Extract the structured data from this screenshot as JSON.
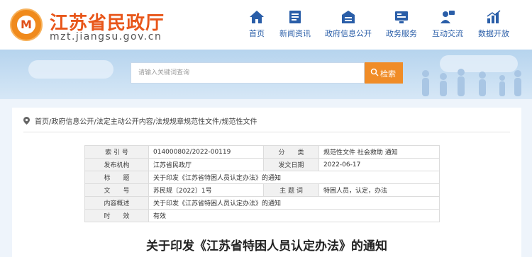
{
  "site": {
    "title": "江苏省民政厅",
    "url": "mzt.jiangsu.gov.cn",
    "logo_mark": "M"
  },
  "nav": [
    {
      "label": "首页",
      "icon": "home-icon"
    },
    {
      "label": "新闻资讯",
      "icon": "news-icon"
    },
    {
      "label": "政府信息公开",
      "icon": "info-disclosure-icon"
    },
    {
      "label": "政务服务",
      "icon": "service-icon"
    },
    {
      "label": "互动交流",
      "icon": "interaction-icon"
    },
    {
      "label": "数据开放",
      "icon": "chart-icon"
    }
  ],
  "search": {
    "placeholder": "请输入关键词查询",
    "button_label": "检索"
  },
  "breadcrumb": [
    "首页",
    "政府信息公开",
    "法定主动公开内容",
    "法规规章规范性文件",
    "规范性文件"
  ],
  "breadcrumb_sep": "/",
  "meta": {
    "index_no_label": "索 引 号",
    "index_no": "014000802/2022-00119",
    "category_label": "分　　类",
    "category": "规范性文件 社会救助 通知",
    "publisher_label": "发布机构",
    "publisher": "江苏省民政厅",
    "date_label": "发文日期",
    "date": "2022-06-17",
    "title_label": "标　　题",
    "title": "关于印发《江苏省特困人员认定办法》的通知",
    "doc_no_label": "文　　号",
    "doc_no": "苏民规〔2022〕1号",
    "topic_label": "主 题 词",
    "topic": "特困人员，认定，办法",
    "summary_label": "内容概述",
    "summary": "关于印发《江苏省特困人员认定办法》的通知",
    "validity_label": "时　　效",
    "validity": "有效"
  },
  "document_title": "关于印发《江苏省特困人员认定办法》的通知",
  "colors": {
    "brand_orange": "#e8561a",
    "nav_blue": "#2a5ea8",
    "search_button": "#f08c27",
    "banner_blue": "#b6d4ee"
  }
}
